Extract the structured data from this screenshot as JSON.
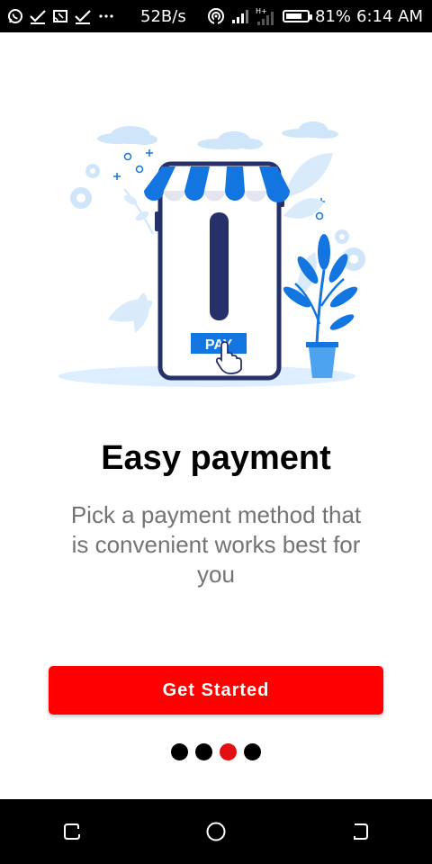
{
  "status_bar": {
    "net_speed": "52B/s",
    "battery_percent": "81%",
    "battery_level": 0.81,
    "time": "6:14 AM",
    "left_icons": [
      "whatsapp-icon",
      "check-icon",
      "cast-icon",
      "download-check-icon",
      "more-dots-icon"
    ],
    "right_icons": [
      "hotspot-icon",
      "signal-icon",
      "data-signal-icon",
      "battery-icon"
    ]
  },
  "illustration": {
    "pay_label": "PAY",
    "colors": {
      "navy": "#26306b",
      "blue": "#1376e0",
      "light_blue": "#cfe5f9",
      "pale": "#e9f3fd"
    }
  },
  "onboarding": {
    "title": "Easy payment",
    "subtitle": "Pick a payment method that is convenient works best for you",
    "cta_label": "Get Started",
    "accent_color": "#ff0000",
    "page_count": 4,
    "current_page": 3
  },
  "nav_bar": {
    "icons": [
      "recent-apps-icon",
      "home-icon",
      "back-icon"
    ]
  }
}
